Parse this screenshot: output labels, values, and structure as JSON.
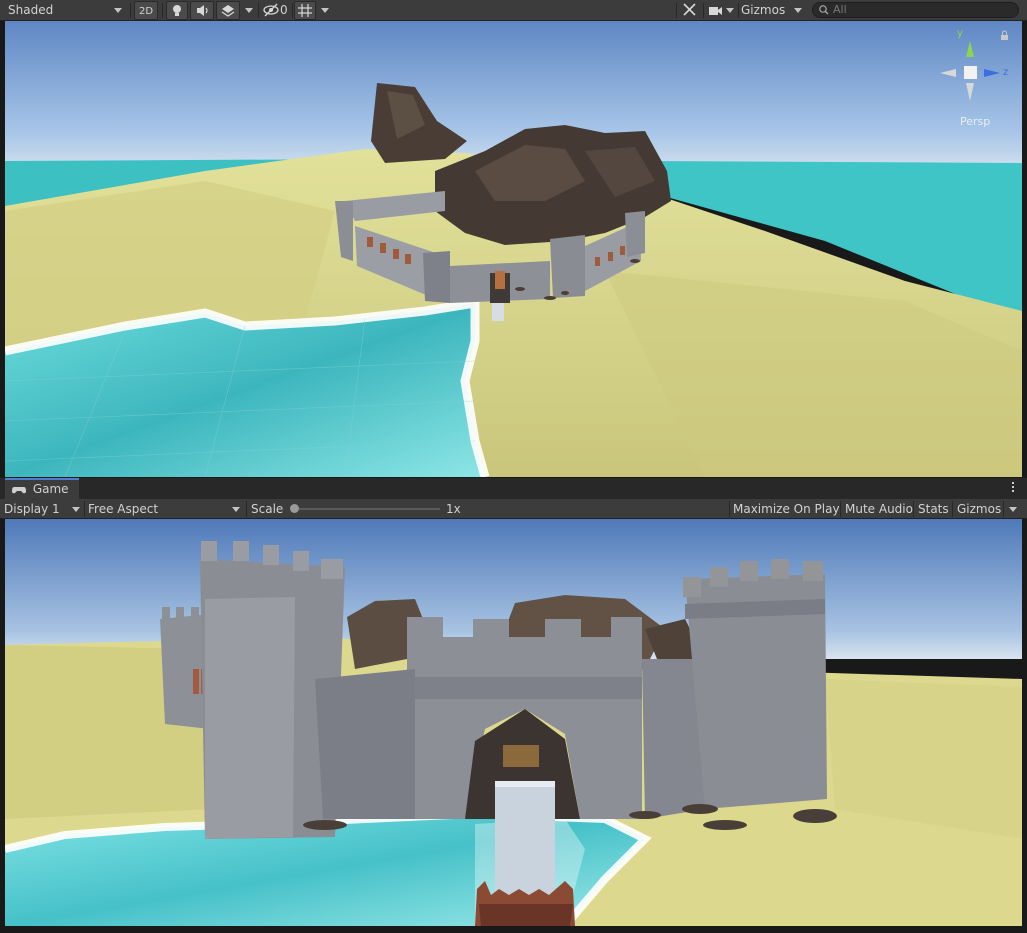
{
  "scene_toolbar": {
    "shading_mode": "Shaded",
    "mode_2d": "2D",
    "hidden_count": "0",
    "gizmos": "Gizmos",
    "search_placeholder": "All"
  },
  "scene_gizmo": {
    "y_axis": "y",
    "z_axis": "z",
    "projection": "Persp"
  },
  "game_tab": {
    "label": "Game"
  },
  "game_toolbar": {
    "display": "Display 1",
    "aspect": "Free Aspect",
    "scale_label": "Scale",
    "scale_value": "1x",
    "maximize_on_play": "Maximize On Play",
    "mute_audio": "Mute Audio",
    "stats": "Stats",
    "gizmos": "Gizmos"
  },
  "colors": {
    "editor_bg": "#3c3c3c",
    "sky": "#86aede",
    "sand": "#d6d48c",
    "water": "#52c8c8",
    "stone": "#8a8c94",
    "rock": "#4a3e36",
    "accent_tab": "#4c7fd0"
  },
  "icons": [
    "light-icon",
    "audio-icon",
    "effects-icon",
    "visibility-icon",
    "grid-icon",
    "tools-icon",
    "camera-icon",
    "search-icon",
    "lock-icon",
    "gamepad-icon",
    "more-icon"
  ]
}
